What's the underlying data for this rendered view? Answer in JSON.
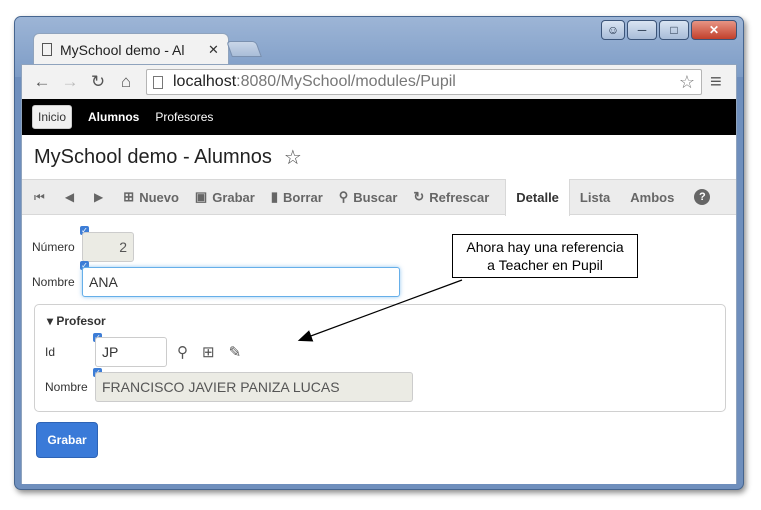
{
  "browser": {
    "tab_title": "MySchool demo - Al",
    "url_host": "localhost",
    "url_path": ":8080/MySchool/modules/Pupil"
  },
  "topnav": {
    "items": [
      "Inicio",
      "Alumnos",
      "Profesores"
    ]
  },
  "module": {
    "title": "MySchool demo - Alumnos"
  },
  "toolbar": {
    "nuevo": "Nuevo",
    "grabar": "Grabar",
    "borrar": "Borrar",
    "buscar": "Buscar",
    "refrescar": "Refrescar",
    "tabs": [
      "Detalle",
      "Lista",
      "Ambos"
    ],
    "help": "?"
  },
  "form": {
    "numero_label": "Número",
    "numero_value": "2",
    "nombre_label": "Nombre",
    "nombre_value": "ANA",
    "profesor_title": "Profesor",
    "id_label": "Id",
    "id_value": "JP",
    "prof_nombre_label": "Nombre",
    "prof_nombre_value": "FRANCISCO JAVIER PANIZA LUCAS",
    "save_label": "Grabar"
  },
  "callout": {
    "line1": "Ahora hay una referencia",
    "line2": "a Teacher en Pupil"
  },
  "colors": {
    "accent": "#3a7ad8",
    "topnav_bg": "#000000"
  }
}
